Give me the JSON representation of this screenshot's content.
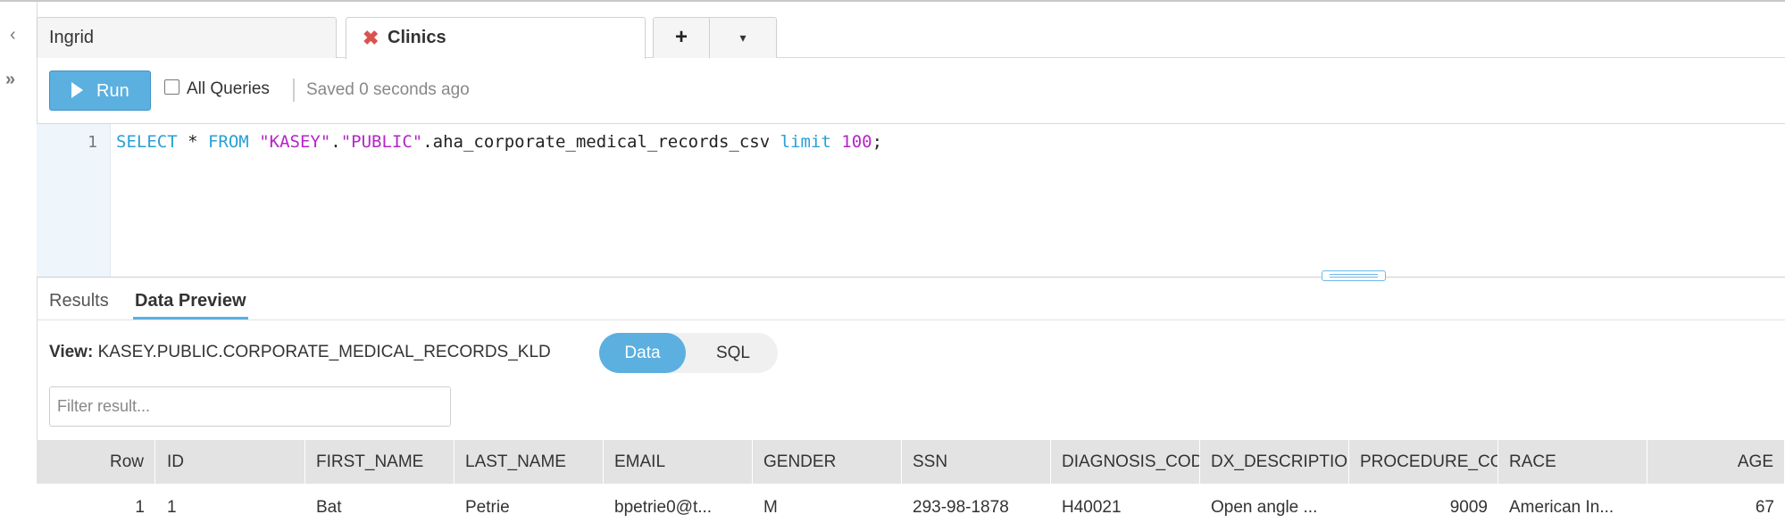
{
  "tabs": [
    {
      "label": "Ingrid",
      "active": false
    },
    {
      "label": "Clinics",
      "active": true
    }
  ],
  "tab_actions": {
    "add": "+",
    "menu": "▾"
  },
  "toolbar": {
    "run_label": "Run",
    "all_queries_label": "All Queries",
    "all_queries_checked": false,
    "saved_status": "Saved 0 seconds ago"
  },
  "editor": {
    "line_number": "1",
    "tokens": {
      "select": "SELECT",
      "star": " * ",
      "from": "FROM",
      "sp": " ",
      "db": "\"KASEY\"",
      "dot1": ".",
      "schema": "\"PUBLIC\"",
      "table": ".aha_corporate_medical_records_csv ",
      "limit": "limit",
      "sp2": " ",
      "n": "100",
      "semi": ";"
    }
  },
  "results_tabs": [
    {
      "label": "Results",
      "active": false
    },
    {
      "label": "Data Preview",
      "active": true
    }
  ],
  "view": {
    "label": "View:",
    "name": "KASEY.PUBLIC.CORPORATE_MEDICAL_RECORDS_KLD",
    "toggle_data": "Data",
    "toggle_sql": "SQL",
    "selected": "Data"
  },
  "filter": {
    "placeholder": "Filter result...",
    "value": ""
  },
  "table": {
    "columns": [
      "Row",
      "ID",
      "FIRST_NAME",
      "LAST_NAME",
      "EMAIL",
      "GENDER",
      "SSN",
      "DIAGNOSIS_COD",
      "DX_DESCRIPTIO",
      "PROCEDURE_CO",
      "RACE",
      "AGE"
    ],
    "rows": [
      [
        "1",
        "1",
        "Bat",
        "Petrie",
        "bpetrie0@t...",
        "M",
        "293-98-1878",
        "H40021",
        "Open angle ...",
        "9009",
        "American In...",
        "67"
      ]
    ]
  },
  "colors": {
    "accent": "#5bb0e0",
    "close_x": "#d9534f",
    "sql_keyword": "#2a9fd6",
    "sql_string": "#b624c9"
  },
  "icons": {
    "collapse": "chevron-left-icon",
    "expand_sidebar": "double-chevron-right-icon",
    "close_tab": "close-icon",
    "run": "play-icon"
  }
}
